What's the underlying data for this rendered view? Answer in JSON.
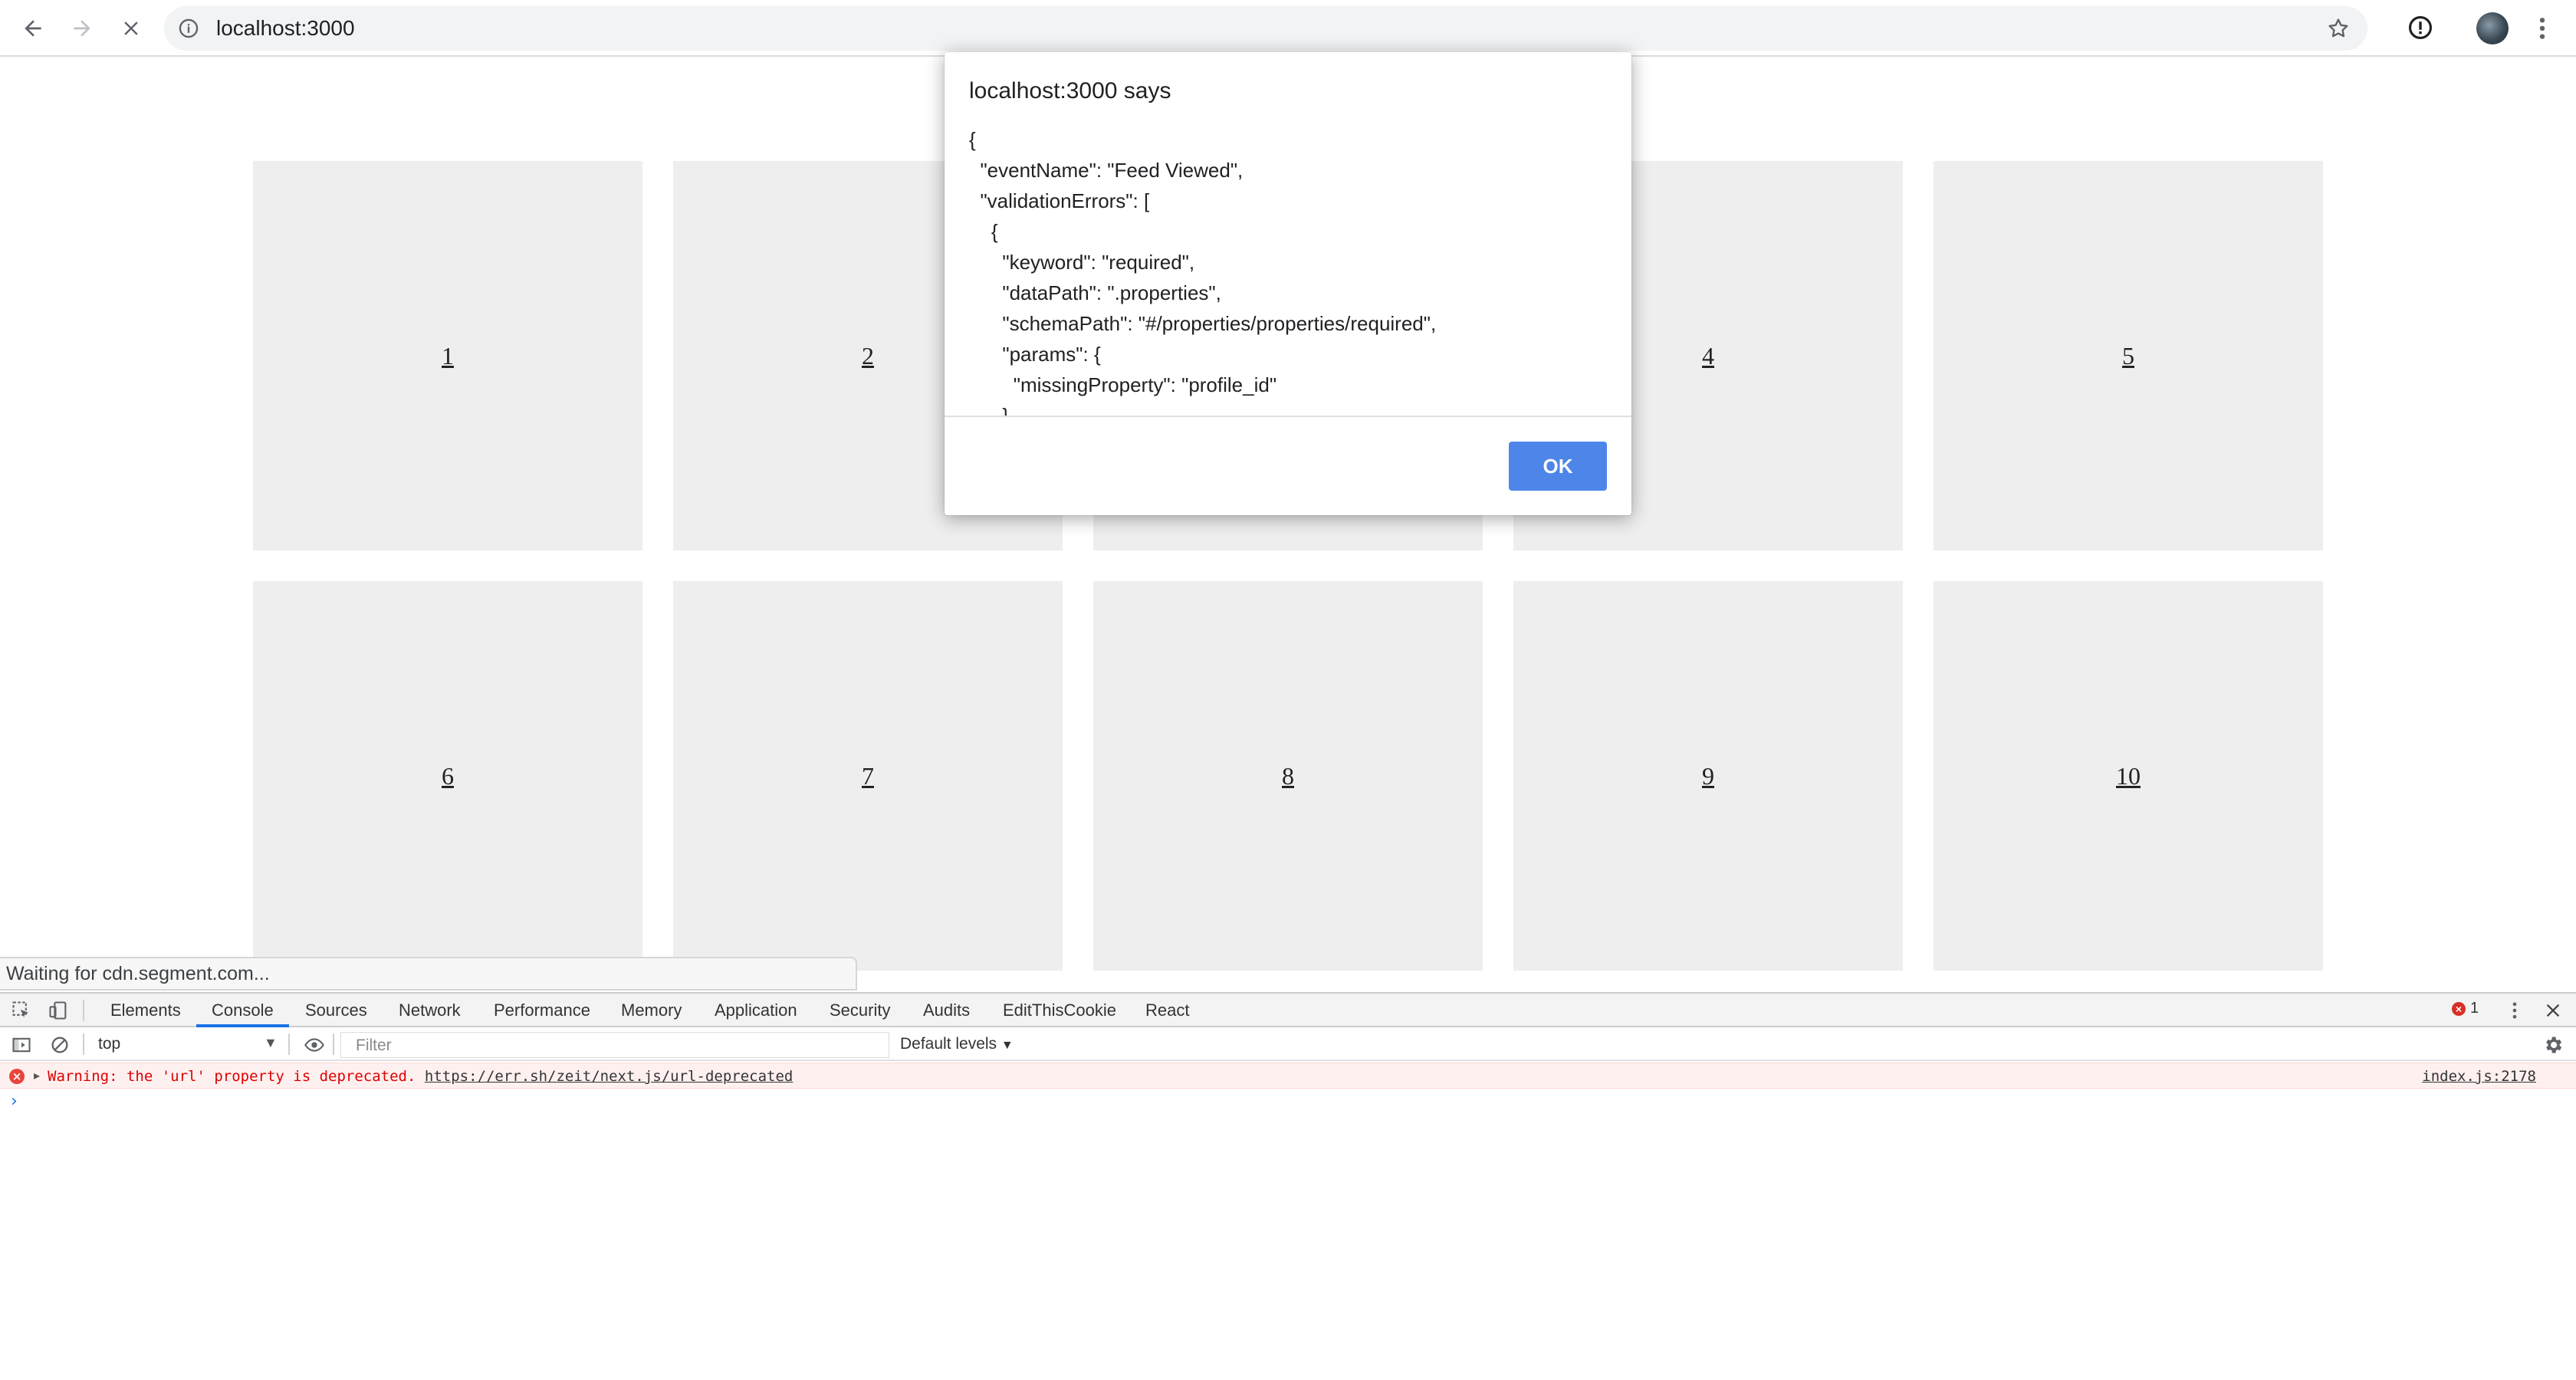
{
  "browser": {
    "url": "localhost:3000",
    "icons": {
      "back": "arrow-left-icon",
      "forward": "arrow-right-icon",
      "stop": "close-icon",
      "info": "info-icon",
      "bookmark": "star-icon",
      "extension": "alert-circle-icon",
      "profile": "avatar",
      "menu": "more-vert-icon"
    }
  },
  "page": {
    "tiles": [
      "1",
      "2",
      "3",
      "4",
      "5",
      "6",
      "7",
      "8",
      "9",
      "10"
    ]
  },
  "dialog": {
    "title": "localhost:3000 says",
    "body": "{\n  \"eventName\": \"Feed Viewed\",\n  \"validationErrors\": [\n    {\n      \"keyword\": \"required\",\n      \"dataPath\": \".properties\",\n      \"schemaPath\": \"#/properties/properties/required\",\n      \"params\": {\n        \"missingProperty\": \"profile_id\"\n      }\n    }\n  ]\n}",
    "ok_label": "OK",
    "ok_color": "#4d86e8"
  },
  "status_bar": {
    "text": "Waiting for cdn.segment.com..."
  },
  "devtools": {
    "tabs": [
      "Elements",
      "Console",
      "Sources",
      "Network",
      "Performance",
      "Memory",
      "Application",
      "Security",
      "Audits",
      "EditThisCookie",
      "React"
    ],
    "active_tab": "Console",
    "error_count": "1",
    "context": "top",
    "filter_placeholder": "Filter",
    "levels_label": "Default levels",
    "console": {
      "error_prefix": "Warning: the 'url' property is deprecated. ",
      "error_link": "https://err.sh/zeit/next.js/url-deprecated",
      "error_source": "index.js:2178",
      "prompt": "›"
    }
  }
}
